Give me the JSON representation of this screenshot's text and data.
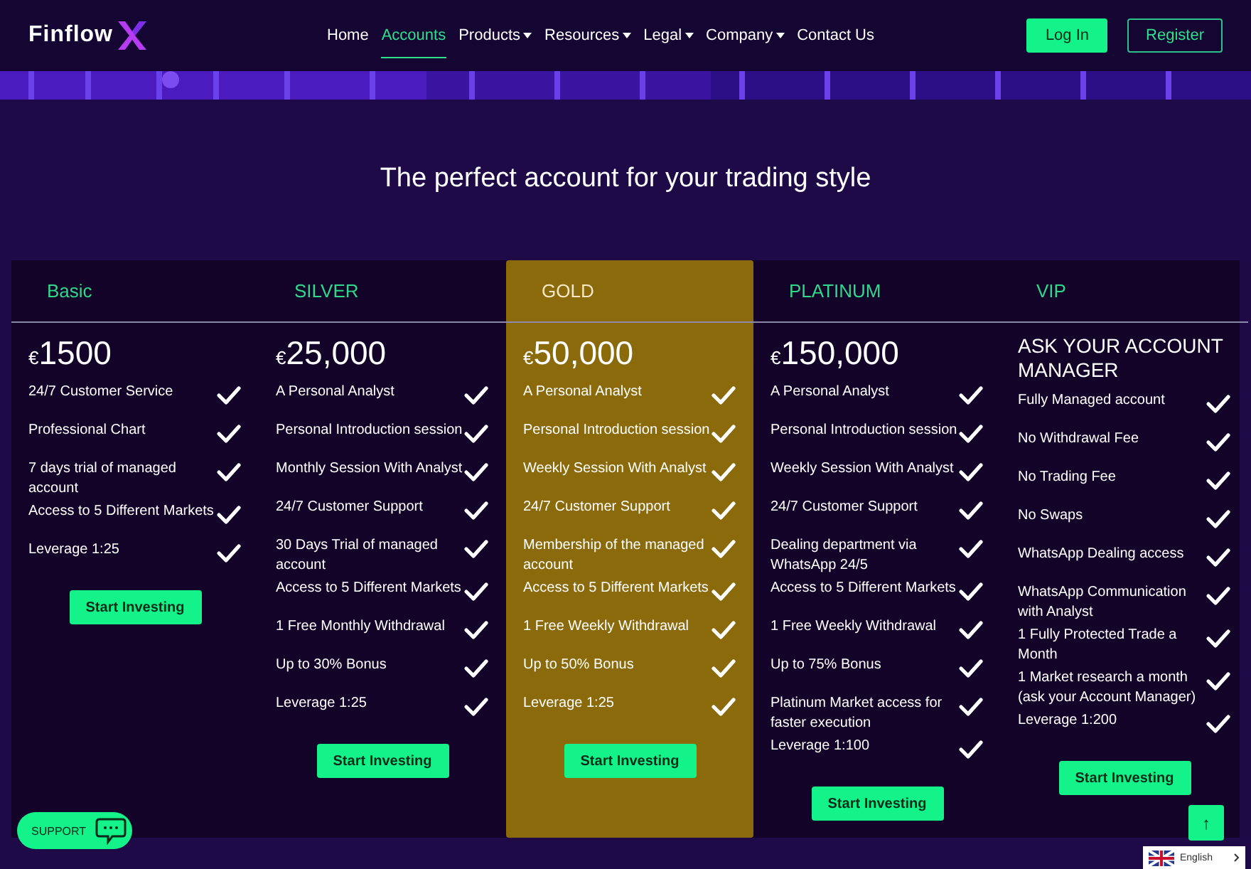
{
  "header": {
    "logo": "Finflow",
    "nav": [
      {
        "label": "Home",
        "selected": false,
        "has_menu": false
      },
      {
        "label": "Accounts",
        "selected": true,
        "has_menu": false
      },
      {
        "label": "Products",
        "selected": false,
        "has_menu": true
      },
      {
        "label": "Resources",
        "selected": false,
        "has_menu": true
      },
      {
        "label": "Legal",
        "selected": false,
        "has_menu": true
      },
      {
        "label": "Company",
        "selected": false,
        "has_menu": true
      },
      {
        "label": "Contact Us",
        "selected": false,
        "has_menu": false
      }
    ],
    "buttons": [
      {
        "label": "Log In",
        "kind": "filled"
      },
      {
        "label": "Register",
        "kind": "outline"
      }
    ]
  },
  "heading": "The perfect account for your trading style",
  "plans": [
    {
      "name": "Basic",
      "selected": false,
      "price": {
        "kind": "amount",
        "currency": "€",
        "amount": "1500"
      },
      "features": [
        "24/7 Customer Service",
        "Professional Chart",
        "7 days trial of managed account",
        "Access to 5 Different Markets",
        "Leverage 1:25"
      ],
      "button": "Start Investing"
    },
    {
      "name": "SILVER",
      "selected": false,
      "price": {
        "kind": "amount",
        "currency": "€",
        "amount": "25,000"
      },
      "features": [
        "A Personal Analyst",
        "Personal Introduction session",
        "Monthly Session With Analyst",
        "24/7 Customer Support",
        "30 Days Trial of managed account",
        "Access to 5 Different Markets",
        "1 Free Monthly Withdrawal",
        "Up to 30% Bonus",
        "Leverage 1:25"
      ],
      "button": "Start Investing"
    },
    {
      "name": "GOLD",
      "selected": true,
      "price": {
        "kind": "amount",
        "currency": "€",
        "amount": "50,000"
      },
      "features": [
        "A Personal Analyst",
        "Personal Introduction session",
        "Weekly Session With Analyst",
        "24/7 Customer Support",
        "Membership of the managed account",
        "Access to 5 Different Markets",
        "1 Free Weekly Withdrawal",
        "Up to 50% Bonus",
        "Leverage 1:25"
      ],
      "button": "Start Investing"
    },
    {
      "name": "PLATINUM",
      "selected": false,
      "price": {
        "kind": "amount",
        "currency": "€",
        "amount": "150,000"
      },
      "features": [
        "A Personal Analyst",
        "Personal Introduction session",
        "Weekly Session With Analyst",
        "24/7 Customer Support",
        "Dealing department via WhatsApp 24/5",
        "Access to 5 Different Markets",
        "1 Free Weekly Withdrawal",
        "Up to 75% Bonus",
        "Platinum Market access for faster execution",
        "Leverage 1:100"
      ],
      "button": "Start Investing"
    },
    {
      "name": "VIP",
      "selected": false,
      "price": {
        "kind": "text",
        "text": "ASK YOUR ACCOUNT MANAGER"
      },
      "features": [
        "Fully Managed account",
        "No Withdrawal Fee",
        "No Trading Fee",
        "No Swaps",
        "WhatsApp Dealing access",
        "WhatsApp Communication with Analyst",
        "1 Fully Protected Trade a Month",
        "1 Market research a month (ask your Account Manager)",
        "Leverage 1:200"
      ],
      "button": "Start Investing"
    }
  ],
  "support": {
    "label": "SUPPORT"
  },
  "scroll_top": {
    "label": "↑"
  },
  "language": {
    "label": "English"
  }
}
